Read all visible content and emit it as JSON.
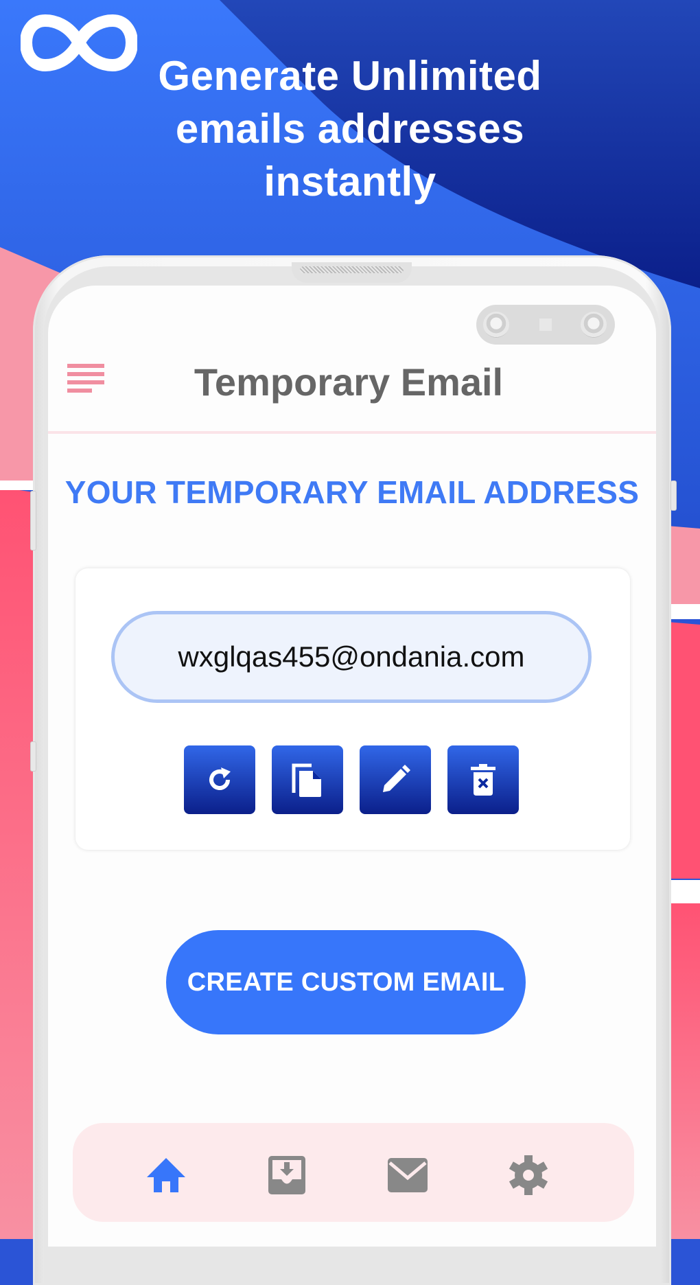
{
  "promo": {
    "logo_icon": "infinity-icon",
    "headline_lines": [
      "Generate Unlimited",
      "emails addresses",
      "instantly"
    ]
  },
  "app": {
    "title": "Temporary Email",
    "menu_icon": "hamburger-menu-icon",
    "section_title": "YOUR TEMPORARY EMAIL ADDRESS",
    "email_value": "wxglqas455@ondania.com",
    "actions": [
      {
        "name": "refresh",
        "icon": "refresh-icon"
      },
      {
        "name": "copy",
        "icon": "copy-icon"
      },
      {
        "name": "edit",
        "icon": "pencil-icon"
      },
      {
        "name": "delete",
        "icon": "trash-icon"
      }
    ],
    "create_button_label": "CREATE CUSTOM EMAIL",
    "bottom_nav": [
      {
        "name": "home",
        "icon": "home-icon",
        "active": true
      },
      {
        "name": "inbox",
        "icon": "inbox-download-icon",
        "active": false
      },
      {
        "name": "mail",
        "icon": "envelope-icon",
        "active": false
      },
      {
        "name": "settings",
        "icon": "gear-icon",
        "active": false
      }
    ]
  },
  "colors": {
    "accent_blue": "#3776fa",
    "action_button_top": "#3167e8",
    "action_button_bottom": "#0b1f8a",
    "menu_pink": "#f08ea0",
    "nav_bg": "#fdeaec",
    "nav_inactive": "#888888",
    "title_gray": "#666666"
  }
}
